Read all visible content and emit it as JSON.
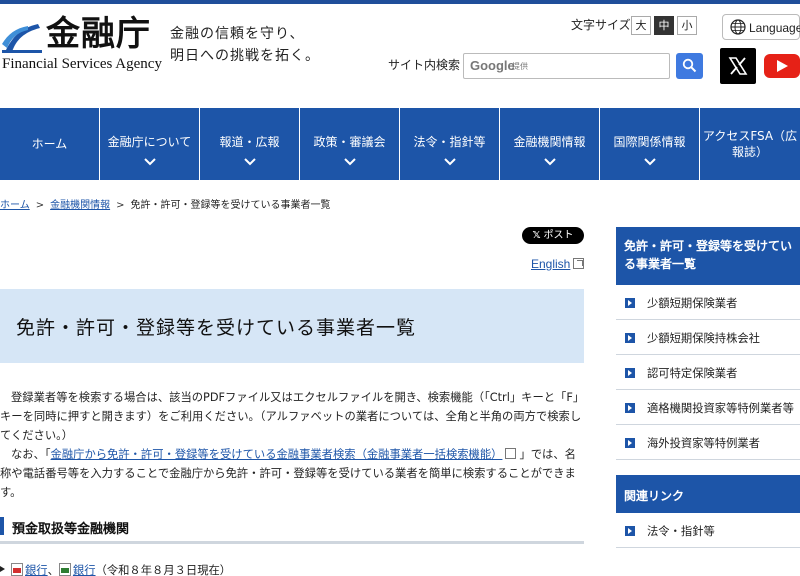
{
  "header": {
    "logo_kanji": "金融庁",
    "logo_en": "Financial Services Agency",
    "tagline_line1": "金融の信頼を守り、",
    "tagline_line2": "明日への挑戦を拓く。",
    "fontsize_label": "文字サイズ",
    "fontsize_options": [
      "大",
      "中",
      "小"
    ],
    "fontsize_selected": "中",
    "language_label": "Language",
    "search_label": "サイト内検索",
    "search_google": "Google",
    "search_google_sub": "提供"
  },
  "nav": {
    "items": [
      {
        "label": "ホーム"
      },
      {
        "label": "金融庁について"
      },
      {
        "label": "報道・広報"
      },
      {
        "label": "政策・審議会"
      },
      {
        "label": "法令・指針等"
      },
      {
        "label": "金融機関情報"
      },
      {
        "label": "国際関係情報"
      },
      {
        "label": "アクセスFSA（広報誌）"
      }
    ],
    "last_line1": "アクセスFSA（広",
    "last_line2": "報誌）"
  },
  "breadcrumb": {
    "items": [
      "ホーム",
      "金融機関情報",
      "免許・許可・登録等を受けている事業者一覧"
    ],
    "separator": ">"
  },
  "main": {
    "post_label": "ポスト",
    "english_link": "English",
    "title": "免許・許可・登録等を受けている事業者一覧",
    "para1": "登録業者等を検索する場合は、該当のPDFファイル又はエクセルファイルを開き、検索機能（「Ctrl」キーと「F」キーを同時に押すと開きます）をご利用ください。（アルファベットの業者については、全角と半角の両方で検索してください。）",
    "para2_prefix": "なお、「",
    "para2_link": "金融庁から免許・許可・登録等を受けている金融事業者検索（金融事業者一括検索機能）",
    "para2_suffix": "」では、名称や電話番号等を入力することで金融庁から免許・許可・登録等を受けている業者を簡単に検索することができます。",
    "section_heading": "預金取扱等金融機関",
    "file_link1": "銀行",
    "file_sep": "、",
    "file_link2": "銀行",
    "file_date": "（令和８年８月３日現在）"
  },
  "sidebar": {
    "heading": "免許・許可・登録等を受けている事業者一覧",
    "items": [
      {
        "label": "少額短期保険業者"
      },
      {
        "label": "少額短期保険持株会社"
      },
      {
        "label": "認可特定保険業者"
      },
      {
        "label": "適格機関投資家等特例業者等"
      },
      {
        "label": "海外投資家等特例業者"
      }
    ],
    "related_heading": "関連リンク",
    "related_items": [
      {
        "label": "法令・指針等"
      }
    ]
  },
  "colors": {
    "brand_blue": "#1d55a8",
    "title_bg": "#d6e6f6",
    "youtube_red": "#e62117"
  }
}
